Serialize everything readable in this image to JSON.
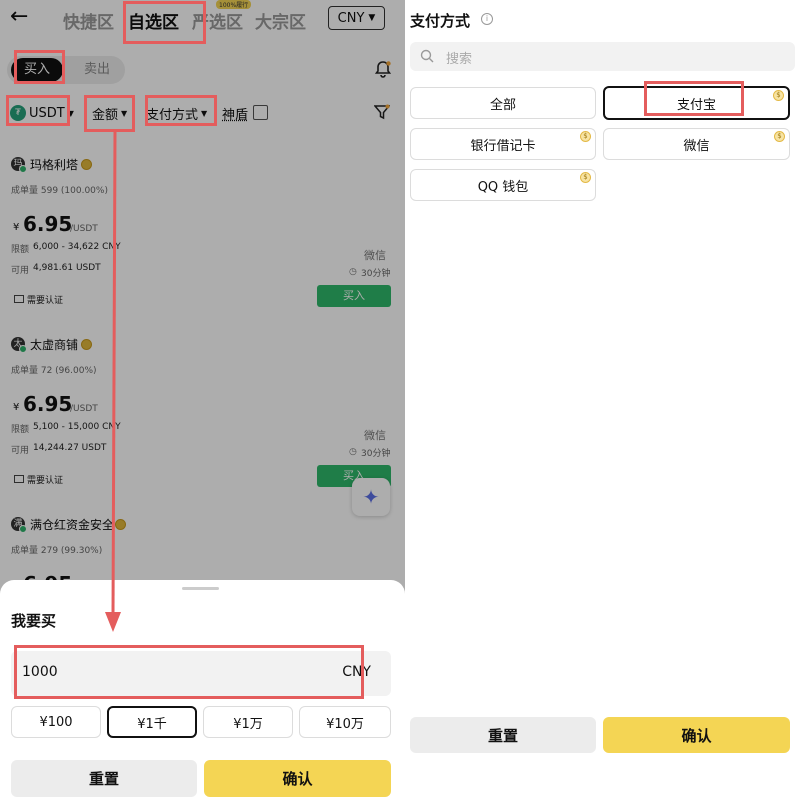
{
  "left": {
    "header": {
      "tabs": [
        {
          "label": "快捷区",
          "active": false
        },
        {
          "label": "自选区",
          "active": true
        },
        {
          "label": "严选区",
          "active": false,
          "badge": "100%履行"
        },
        {
          "label": "大宗区",
          "active": false
        }
      ],
      "currency": "CNY"
    },
    "side_tabs": {
      "buy": "买入",
      "sell": "卖出"
    },
    "filters": {
      "coin": "USDT",
      "amount": "金额",
      "payment": "支付方式",
      "shield": "神盾"
    },
    "merchants": [
      {
        "avatar": "玛",
        "name": "玛格利塔",
        "stats": "成单量 599 (100.00%)",
        "currency_symbol": "¥",
        "price": "6.95",
        "unit": "/USDT",
        "limit_label": "限额",
        "limit": "6,000 - 34,622 CNY",
        "available_label": "可用",
        "available": "4,981.61 USDT",
        "payment": "微信",
        "time": "30分钟",
        "verify": "需要认证",
        "button": "买入"
      },
      {
        "avatar": "太",
        "name": "太虚商铺",
        "stats": "成单量 72 (96.00%)",
        "currency_symbol": "¥",
        "price": "6.95",
        "unit": "/USDT",
        "limit_label": "限额",
        "limit": "5,100 - 15,000 CNY",
        "available_label": "可用",
        "available": "14,244.27 USDT",
        "payment": "微信",
        "time": "30分钟",
        "verify": "需要认证",
        "button": "买入"
      },
      {
        "avatar": "满",
        "name": "满仓红资金安全",
        "stats": "成单量 279 (99.30%)",
        "currency_symbol": "¥",
        "price": "6.95"
      }
    ],
    "sheet": {
      "title": "我要买",
      "input_value": "1000",
      "input_currency": "CNY",
      "quick_amounts": [
        {
          "label": "¥100",
          "selected": false
        },
        {
          "label": "¥1千",
          "selected": true
        },
        {
          "label": "¥1万",
          "selected": false
        },
        {
          "label": "¥10万",
          "selected": false
        }
      ],
      "reset": "重置",
      "confirm": "确认"
    }
  },
  "right": {
    "title": "支付方式",
    "search_placeholder": "搜索",
    "methods": [
      {
        "label": "全部",
        "selected": false,
        "badge": false
      },
      {
        "label": "支付宝",
        "selected": true,
        "badge": true
      },
      {
        "label": "银行借记卡",
        "selected": false,
        "badge": true
      },
      {
        "label": "微信",
        "selected": false,
        "badge": true
      },
      {
        "label": "QQ 钱包",
        "selected": false,
        "badge": true
      }
    ],
    "reset": "重置",
    "confirm": "确认"
  },
  "colors": {
    "accent_yellow": "#f4d554",
    "buy_green": "#2eb86a",
    "annotation_red": "#e45d5d"
  }
}
